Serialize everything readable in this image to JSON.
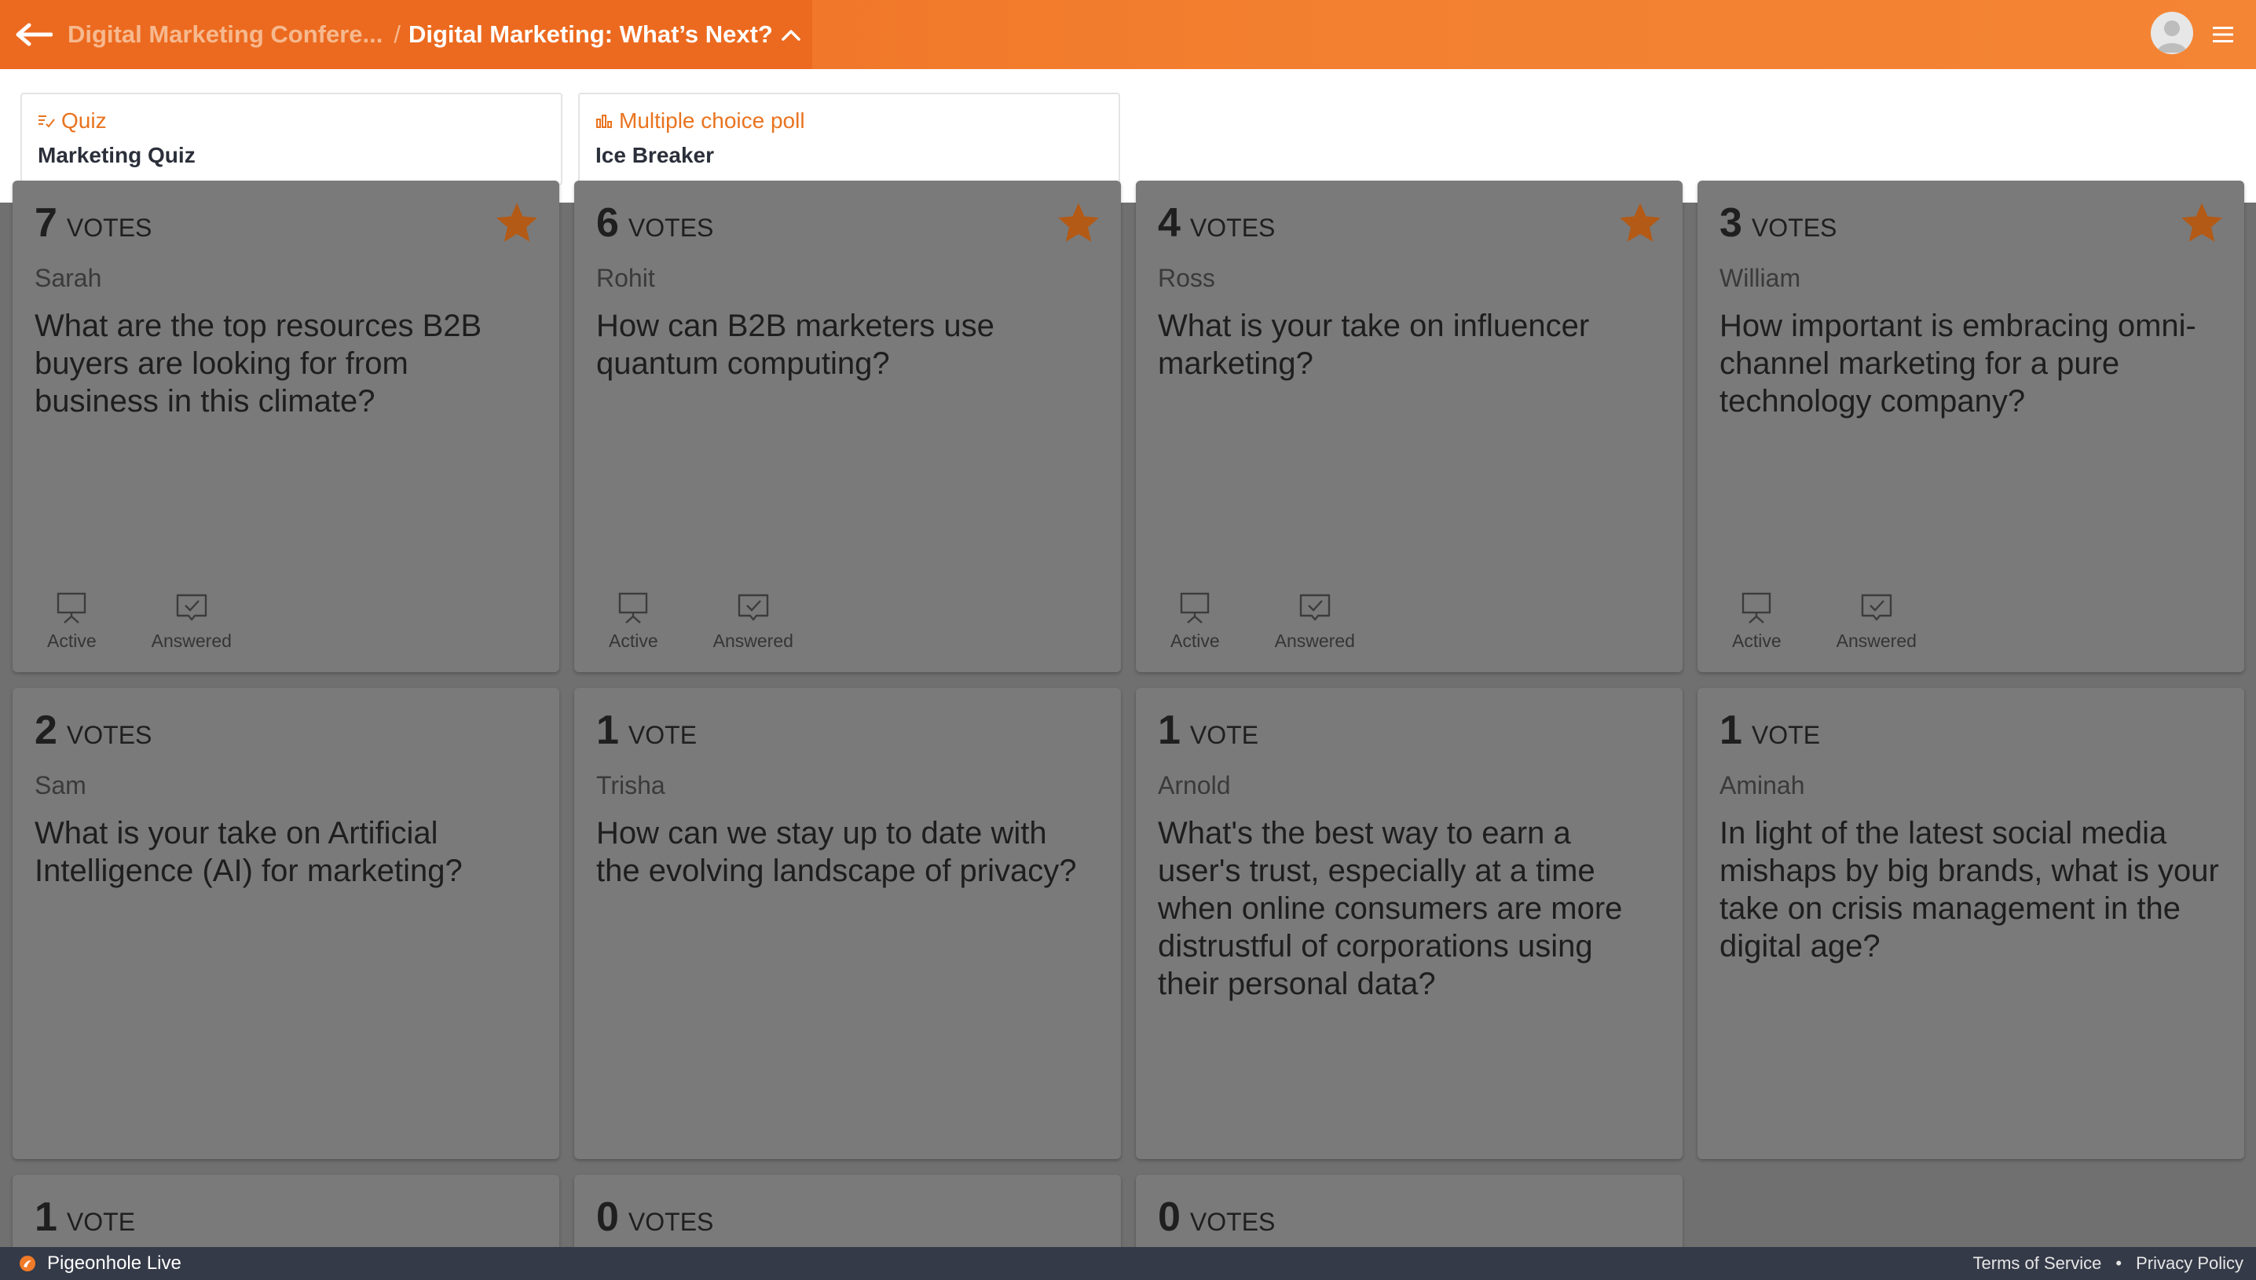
{
  "header": {
    "parent_crumb": "Digital Marketing Confere...",
    "separator": "/",
    "current_crumb": "Digital Marketing: What’s Next?",
    "accent_color": "#ec6a1f"
  },
  "activities": [
    {
      "type": "Quiz",
      "title": "Marketing Quiz",
      "icon": "quiz-icon"
    },
    {
      "type": "Multiple choice poll",
      "title": "Ice Breaker",
      "icon": "poll-icon"
    }
  ],
  "questions": [
    {
      "votes": "7",
      "vote_word": "VOTES",
      "author": "Sarah",
      "text": "What are the top resources B2B buyers are looking for from business in this climate?",
      "starred": true
    },
    {
      "votes": "6",
      "vote_word": "VOTES",
      "author": "Rohit",
      "text": "How can B2B marketers use quantum computing?",
      "starred": true
    },
    {
      "votes": "4",
      "vote_word": "VOTES",
      "author": "Ross",
      "text": "What is your take on influencer marketing?",
      "starred": true
    },
    {
      "votes": "3",
      "vote_word": "VOTES",
      "author": "William",
      "text": "How important is embracing omni-channel marketing for a pure technology company?",
      "starred": true
    },
    {
      "votes": "2",
      "vote_word": "VOTES",
      "author": "Sam",
      "text": "What is your take on Artificial Intelligence (AI) for marketing?",
      "starred": false
    },
    {
      "votes": "1",
      "vote_word": "VOTE",
      "author": "Trisha",
      "text": "How can we stay up to date with the evolving landscape of privacy?",
      "starred": false
    },
    {
      "votes": "1",
      "vote_word": "VOTE",
      "author": "Arnold",
      "text": "What's the best way to earn a user's trust, especially at a time when online consumers are more distrustful of corporations using their personal data?",
      "starred": false
    },
    {
      "votes": "1",
      "vote_word": "VOTE",
      "author": "Aminah",
      "text": "In light of the latest social media mishaps by big brands, what is your take on crisis management in the digital age?",
      "starred": false
    },
    {
      "votes": "1",
      "vote_word": "VOTE",
      "author": "",
      "text": "",
      "starred": false
    },
    {
      "votes": "0",
      "vote_word": "VOTES",
      "author": "",
      "text": "",
      "starred": false
    },
    {
      "votes": "0",
      "vote_word": "VOTES",
      "author": "",
      "text": "",
      "starred": false
    }
  ],
  "question_actions": {
    "active_label": "Active",
    "answered_label": "Answered"
  },
  "footer": {
    "brand": "Pigeonhole Live",
    "terms": "Terms of Service",
    "bullet": "•",
    "privacy": "Privacy Policy"
  },
  "colors": {
    "star": "#b35a16",
    "overlay_background": "#707070"
  }
}
